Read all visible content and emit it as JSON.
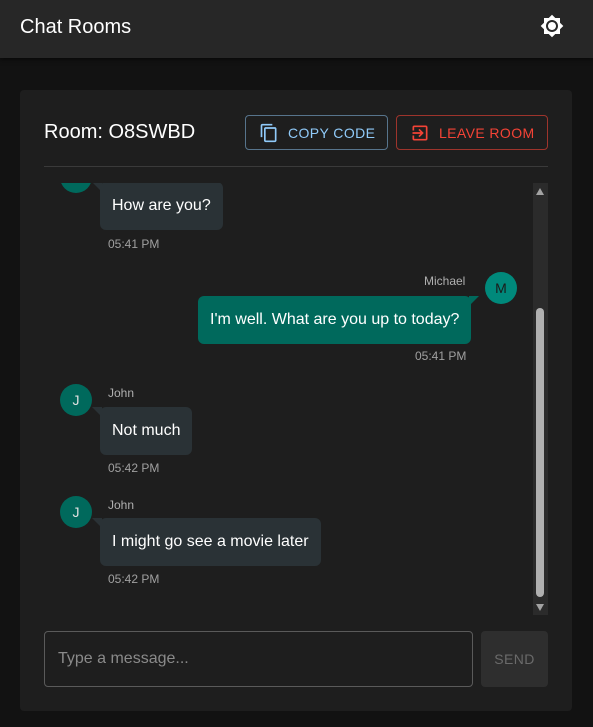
{
  "app": {
    "title": "Chat Rooms",
    "theme_icon": "brightness-icon"
  },
  "room": {
    "label": "Room: O8SWBD",
    "copy_label": "COPY CODE",
    "copy_icon": "copy-icon",
    "leave_label": "LEAVE ROOM",
    "leave_icon": "exit-icon"
  },
  "messages": [
    {
      "sender": "",
      "avatar": "",
      "text": "How are you?",
      "time": "05:41 PM",
      "own": false
    },
    {
      "sender": "Michael",
      "avatar": "M",
      "text": "I'm well. What are you up to today?",
      "time": "05:41 PM",
      "own": true
    },
    {
      "sender": "John",
      "avatar": "J",
      "text": "Not much",
      "time": "05:42 PM",
      "own": false
    },
    {
      "sender": "John",
      "avatar": "J",
      "text": "I might go see a movie later",
      "time": "05:42 PM",
      "own": false
    }
  ],
  "composer": {
    "placeholder": "Type a message...",
    "send_label": "SEND"
  },
  "colors": {
    "accent": "#90caf9",
    "danger": "#f44336",
    "bubble_own": "#00695c",
    "bubble_other": "#2a3236"
  }
}
